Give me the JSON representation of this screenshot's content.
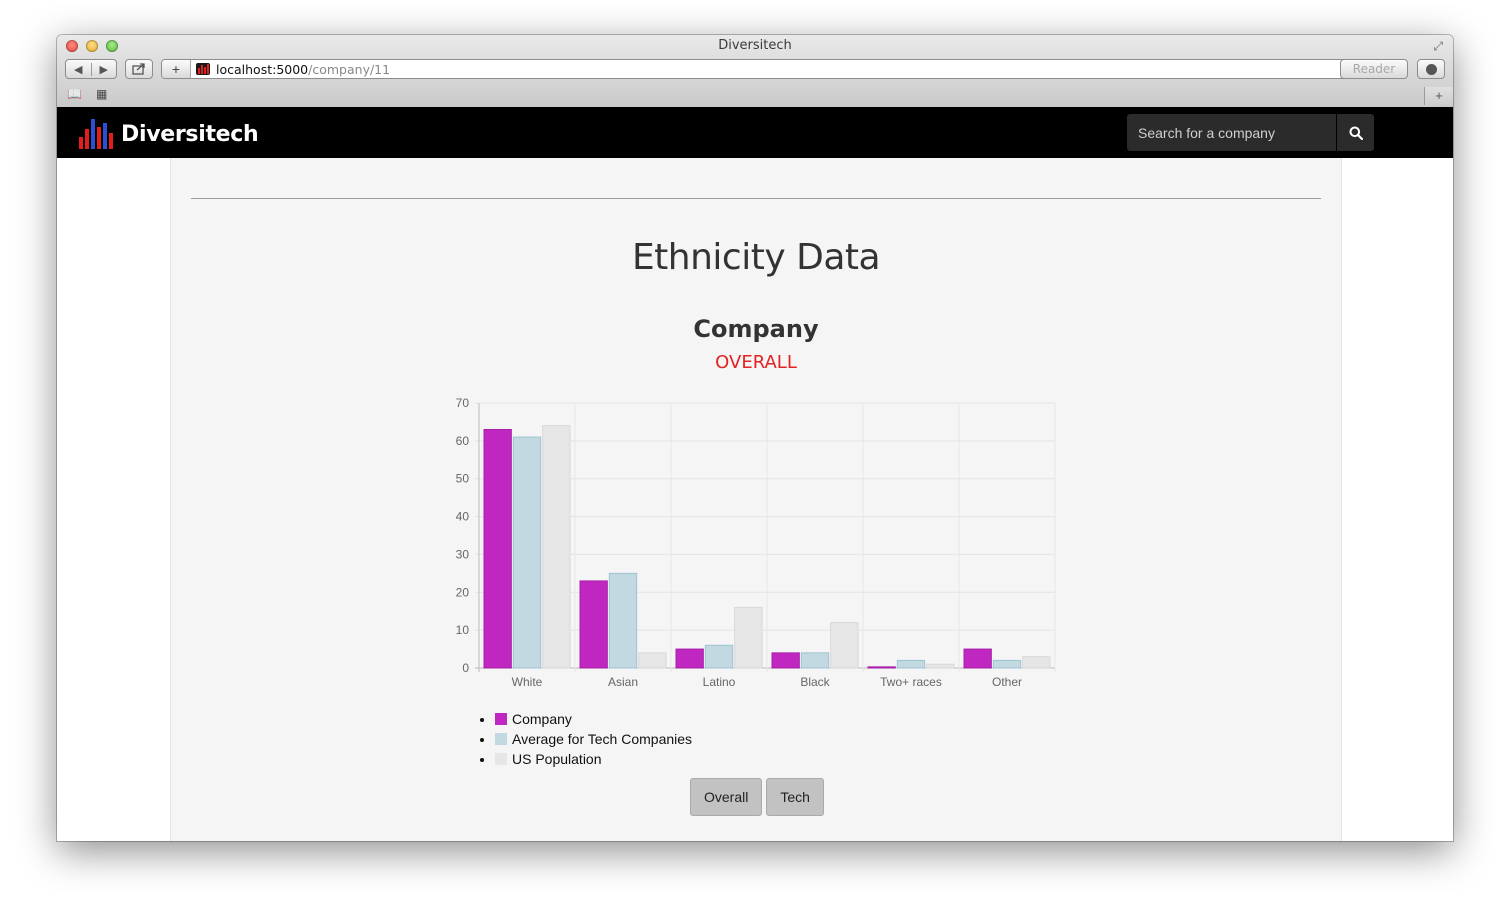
{
  "window": {
    "title": "Diversitech"
  },
  "browser": {
    "url_host": "localhost:5000",
    "url_path": "/company/11",
    "reader_label": "Reader"
  },
  "navbar": {
    "brand": "Diversitech",
    "search": {
      "placeholder": "Search for a company",
      "value": ""
    }
  },
  "page": {
    "heading": "Ethnicity Data",
    "subheading": "Company",
    "view_label": "OVERALL",
    "buttons": {
      "overall": "Overall",
      "tech": "Tech"
    }
  },
  "chart_data": {
    "type": "bar",
    "categories": [
      "White",
      "Asian",
      "Latino",
      "Black",
      "Two+ races",
      "Other"
    ],
    "ylim": [
      0,
      70
    ],
    "yticks": [
      0,
      10,
      20,
      30,
      40,
      50,
      60,
      70
    ],
    "grid": true,
    "series": [
      {
        "name": "Company",
        "values": [
          63,
          23,
          5,
          4,
          0.3,
          5
        ],
        "color": "#c026c0",
        "stroke": "#a81fa8"
      },
      {
        "name": "Average for Tech Companies",
        "values": [
          61,
          25,
          6,
          4,
          2,
          2
        ],
        "color": "#c3d9e1",
        "stroke": "#9ec2d3"
      },
      {
        "name": "US Population",
        "values": [
          64,
          4,
          16,
          12,
          1,
          3
        ],
        "color": "#e6e6e6",
        "stroke": "#d8d8d8"
      }
    ]
  },
  "legend_items": [
    {
      "label": "Company",
      "color": "#c026c0"
    },
    {
      "label": "Average for Tech Companies",
      "color": "#c3d9e1"
    },
    {
      "label": "US Population",
      "color": "#e6e6e6"
    }
  ]
}
